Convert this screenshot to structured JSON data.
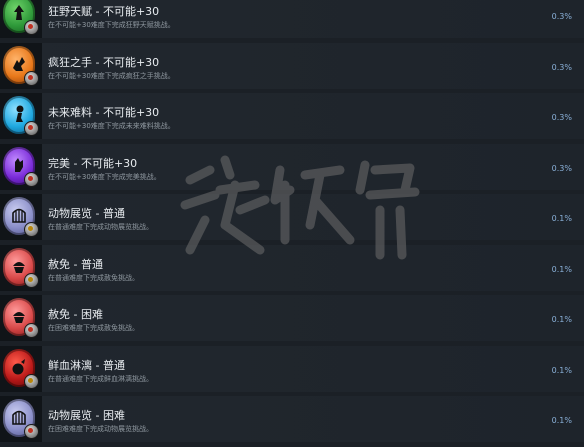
{
  "achievements": [
    {
      "title": "狂野天赋 - 不可能+30",
      "desc": "在不可能+30难度下完成狂野天赋挑战。",
      "percent": "0.3%",
      "icon": "beast-paw-icon",
      "color": "#2f9a3a"
    },
    {
      "title": "疯狂之手 - 不可能+30",
      "desc": "在不可能+30难度下完成疯狂之手挑战。",
      "percent": "0.3%",
      "icon": "crazy-hand-icon",
      "color": "#e8781a"
    },
    {
      "title": "未来难料 - 不可能+30",
      "desc": "在不可能+30难度下完成未来难料挑战。",
      "percent": "0.3%",
      "icon": "mystery-figure-icon",
      "color": "#1fa8e0"
    },
    {
      "title": "完美 - 不可能+30",
      "desc": "在不可能+30难度下完成完美挑战。",
      "percent": "0.3%",
      "icon": "perfect-hand-icon",
      "color": "#7a2bd8"
    },
    {
      "title": "动物展览 - 普通",
      "desc": "在普通难度下完成动物展览挑战。",
      "percent": "0.1%",
      "icon": "cage-icon",
      "color": "#8a8ec8"
    },
    {
      "title": "赦免 - 普通",
      "desc": "在普通难度下完成赦免挑战。",
      "percent": "0.1%",
      "icon": "cupcake-icon",
      "color": "#d84848"
    },
    {
      "title": "赦免 - 困难",
      "desc": "在困难难度下完成赦免挑战。",
      "percent": "0.1%",
      "icon": "cupcake-icon",
      "color": "#d84848"
    },
    {
      "title": "鲜血淋漓 - 普通",
      "desc": "在普通难度下完成鲜血淋漓挑战。",
      "percent": "0.1%",
      "icon": "blood-drop-icon",
      "color": "#b81818"
    },
    {
      "title": "动物展览 - 困难",
      "desc": "在困难难度下完成动物展览挑战。",
      "percent": "0.1%",
      "icon": "cage-icon",
      "color": "#8a8ec8"
    }
  ]
}
